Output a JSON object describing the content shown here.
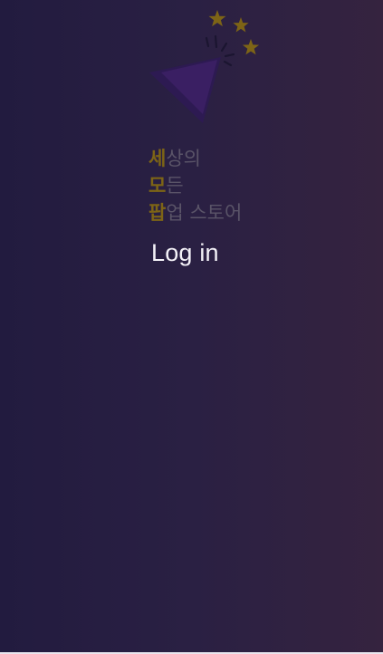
{
  "brand": {
    "line1": {
      "highlight": "세",
      "rest": "상의"
    },
    "line2": {
      "highlight": "모",
      "rest": "든"
    },
    "line3": {
      "highlight": "팝",
      "rest": "업 스토어"
    }
  },
  "auth": {
    "login_label": "Log in"
  },
  "colors": {
    "background_left": "#221b3f",
    "background_right": "#35233f",
    "accent_gold": "#7d6416",
    "text_muted": "#5a5468",
    "text_light": "#f4f2f8",
    "cone_purple": "#3a1f63"
  },
  "icons": {
    "logo": "party-popper-icon",
    "stars": "star-icon"
  }
}
